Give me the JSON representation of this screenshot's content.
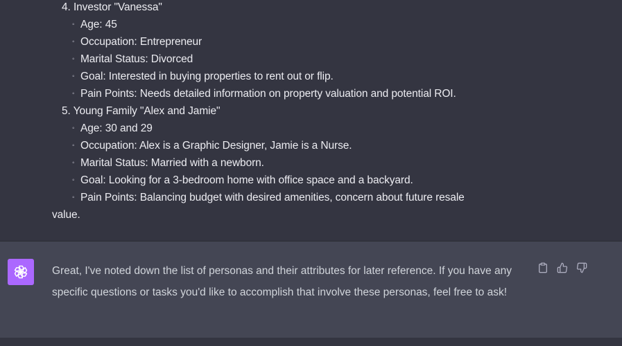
{
  "user_message": {
    "items": [
      {
        "number": "4.",
        "title": "Investor \"Vanessa\""
      },
      {
        "bullet": "◦",
        "text": "Age: 45"
      },
      {
        "bullet": "◦",
        "text": "Occupation: Entrepreneur"
      },
      {
        "bullet": "◦",
        "text": "Marital Status: Divorced"
      },
      {
        "bullet": "◦",
        "text": "Goal: Interested in buying properties to rent out or flip."
      },
      {
        "bullet": "◦",
        "text": "Pain Points: Needs detailed information on property valuation and potential ROI."
      },
      {
        "number": "5.",
        "title": "Young Family \"Alex and Jamie\""
      },
      {
        "bullet": "◦",
        "text": "Age: 30 and 29"
      },
      {
        "bullet": "◦",
        "text": "Occupation: Alex is a Graphic Designer, Jamie is a Nurse."
      },
      {
        "bullet": "◦",
        "text": "Marital Status: Married with a newborn."
      },
      {
        "bullet": "◦",
        "text": "Goal: Looking for a 3-bedroom home with office space and a backyard."
      },
      {
        "bullet": "◦",
        "text": "Pain Points: Balancing budget with desired amenities, concern about future resale"
      },
      {
        "text": "value."
      }
    ]
  },
  "assistant_message": {
    "avatar_icon": "openai-logo-icon",
    "avatar_color": "#ab68ff",
    "text": "Great, I've noted down the list of personas and their attributes for later reference. If you have any specific questions or tasks you'd like to accomplish that involve these personas, feel free to ask!",
    "actions": [
      {
        "icon": "clipboard-icon"
      },
      {
        "icon": "thumbs-up-icon"
      },
      {
        "icon": "thumbs-down-icon"
      }
    ]
  },
  "colors": {
    "background": "#343541",
    "assistant_background": "#444654",
    "text": "#ececf1",
    "icon": "#acacbe"
  }
}
